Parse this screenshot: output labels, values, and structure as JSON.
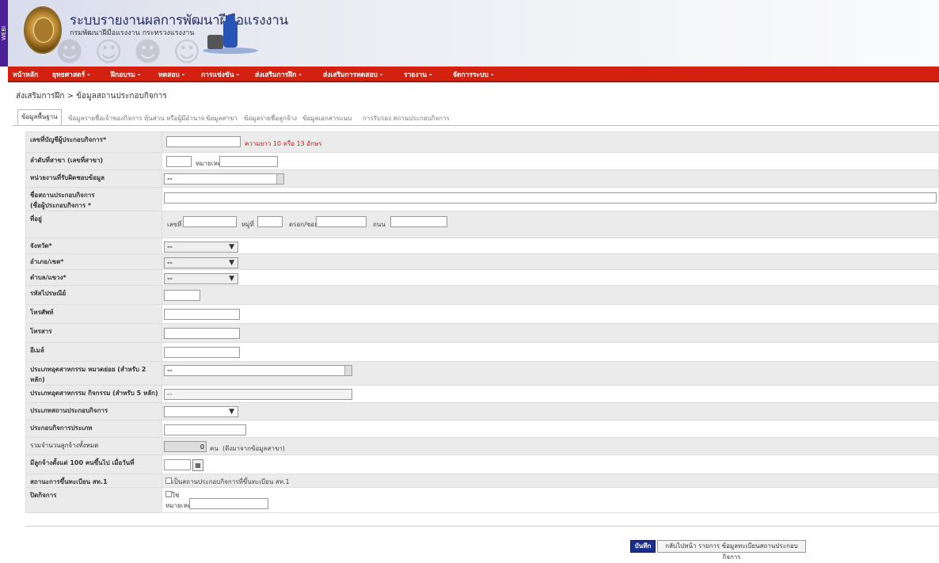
{
  "header": {
    "side_label": "WEBI",
    "title": "ระบบรายงานผลการพัฒนาฝีมือแรงงาน",
    "subtitle": "กรมพัฒนาฝีมือแรงงาน กระทรวงแรงงาน"
  },
  "menu": [
    "หน้าหลัก",
    "ยุทธศาสตร์ -",
    "ฝึกอบรม -",
    "ทดสอบ -",
    "การแข่งขัน -",
    "ส่งเสริมการฝึก -",
    "ส่งเสริมการทดสอบ -",
    "รายงาน -",
    "จัดการระบบ -"
  ],
  "breadcrumb": "ส่งเสริมการฝึก > ข้อมูลสถานประกอบกิจการ",
  "tabs": [
    "ข้อมูลพื้นฐาน",
    "ข้อมูลรายชื่อเจ้าของกิจการ หุ้นส่วน หรือผู้มีอำนาจ",
    "ข้อมูลสาขา",
    "ข้อมูลรายชื่อลูกจ้าง",
    "ข้อมูลเอกสารแนบ",
    "การรับรอง สถานประกอบกิจการ"
  ],
  "form": {
    "tax_id_label": "เลขที่บัญชีผู้ประกอบกิจการ*",
    "tax_id_note": "ความยาว 10 หรือ 13 อักษร",
    "branch_label": "ลำดับที่สาขา (เลขที่สาขา)",
    "branch_note_label": "หมายเหตุ",
    "agency_label": "หน่วยงานที่รับผิดชอบข้อมูล",
    "agency_value": "--",
    "name_label_1": "ชื่อสถานประกอบกิจการ",
    "name_label_2": "(ชื่อผู้ประกอบกิจการ *",
    "address_label": "ที่อยู่",
    "addr_no": "เลขที่",
    "addr_moo": "หมู่ที่",
    "addr_soi": "ตรอก/ซอย",
    "addr_road": "ถนน",
    "province_label": "จังหวัด*",
    "district_label": "อำเภอ/เขต*",
    "subdistrict_label": "ตำบล/แขวง*",
    "dropdown_default": "--",
    "postal_label": "รหัสไปรษณีย์",
    "phone_label": "โทรศัพท์",
    "fax_label": "โทรสาร",
    "email_label": "อีเมล์",
    "industry2_label": "ประเภทอุตสาหกรรม หมวดย่อย (สำหรับ 2 หลัก)",
    "industry5_label": "ประเภทอุตสาหกรรม กิจกรรม (สำหรับ 5 หลัก)",
    "biztype_label": "ประเภทสถานประกอบกิจการ",
    "bizother_label": "ประกอบกิจการประเภท",
    "employees_label": "รวมจำนวนลูกจ้างทั้งหมด",
    "employees_value": "0",
    "employees_unit": "คน",
    "employees_note": "(ดึงมาจากข้อมูลสาขา)",
    "over100_label": "มีลูกจ้างตั้งแต่ 100 คนขึ้นไป เมื่อวันที่",
    "calendar_icon": "calendar-icon",
    "reg_status_label": "สถานะการขึ้นทะเบียน สท.1",
    "reg_status_text": "เป็นสถานประกอบกิจการที่ขึ้นทะเบียน สท.1",
    "closed_label": "ปิดกิจการ",
    "closed_text": "ใช่",
    "closed_note_label": "หมายเหตุ"
  },
  "buttons": {
    "save": "บันทึก",
    "back": "กลับไปหน้า รายการ ข้อมูลทะเบียนสถานประกอบกิจการ"
  },
  "colors": {
    "menu_red": "#d3200f",
    "side_purple": "#4b1f96",
    "save_blue": "#1a2d8a"
  }
}
